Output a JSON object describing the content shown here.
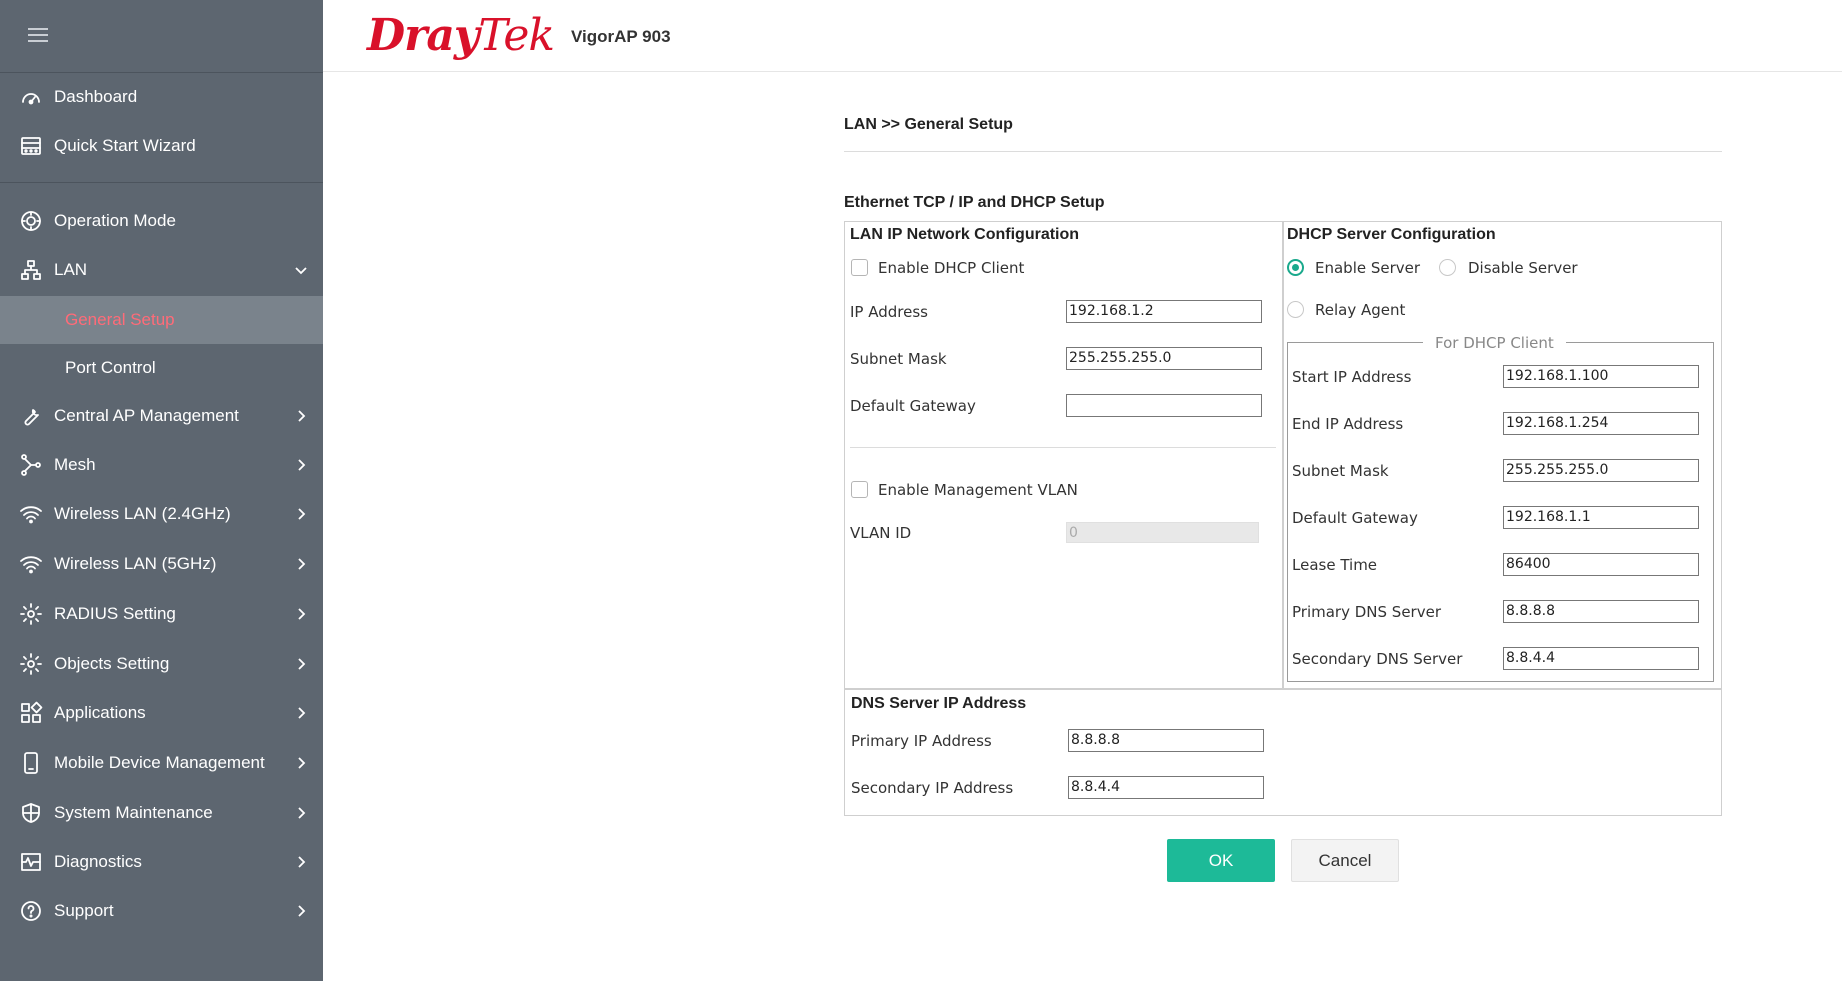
{
  "brand": {
    "logo_dray": "Dray",
    "logo_tek": "Tek",
    "model": "VigorAP 903",
    "logo_color": "#d9112a"
  },
  "sidebar": {
    "items": [
      {
        "label": "Dashboard",
        "icon": "dashboard-icon"
      },
      {
        "label": "Quick Start Wizard",
        "icon": "wizard-icon"
      },
      {
        "label": "Operation Mode",
        "icon": "operation-mode-icon"
      },
      {
        "label": "LAN",
        "icon": "lan-icon"
      },
      {
        "label": "Central AP Management",
        "icon": "wrench-icon"
      },
      {
        "label": "Mesh",
        "icon": "mesh-icon"
      },
      {
        "label": "Wireless LAN (2.4GHz)",
        "icon": "wifi-icon"
      },
      {
        "label": "Wireless LAN (5GHz)",
        "icon": "wifi-icon"
      },
      {
        "label": "RADIUS Setting",
        "icon": "gear-icon"
      },
      {
        "label": "Objects Setting",
        "icon": "gear-icon"
      },
      {
        "label": "Applications",
        "icon": "apps-icon"
      },
      {
        "label": "Mobile Device Management",
        "icon": "mobile-icon"
      },
      {
        "label": "System Maintenance",
        "icon": "globe-icon"
      },
      {
        "label": "Diagnostics",
        "icon": "diagnostics-icon"
      },
      {
        "label": "Support",
        "icon": "help-icon"
      }
    ],
    "lan_sub": [
      {
        "label": "General Setup",
        "active": true
      },
      {
        "label": "Port Control",
        "active": false
      }
    ],
    "active_color": "#ff6b78"
  },
  "page": {
    "breadcrumb": "LAN >> General Setup",
    "section_title": "Ethernet TCP / IP and DHCP Setup"
  },
  "lan_ip": {
    "title": "LAN IP Network Configuration",
    "enable_dhcp_client": "Enable DHCP Client",
    "ip_address_label": "IP Address",
    "ip_address": "192.168.1.2",
    "subnet_mask_label": "Subnet Mask",
    "subnet_mask": "255.255.255.0",
    "default_gateway_label": "Default Gateway",
    "default_gateway": "",
    "enable_mgmt_vlan": "Enable Management VLAN",
    "vlan_id_label": "VLAN ID",
    "vlan_id": "0"
  },
  "dhcp": {
    "title": "DHCP Server Configuration",
    "enable_server": "Enable Server",
    "disable_server": "Disable Server",
    "relay_agent": "Relay Agent",
    "legend": "For DHCP Client",
    "start_ip_label": "Start IP Address",
    "start_ip": "192.168.1.100",
    "end_ip_label": "End IP Address",
    "end_ip": "192.168.1.254",
    "subnet_mask_label": "Subnet Mask",
    "subnet_mask": "255.255.255.0",
    "default_gateway_label": "Default Gateway",
    "default_gateway": "192.168.1.1",
    "lease_time_label": "Lease Time",
    "lease_time": "86400",
    "primary_dns_label": "Primary DNS Server",
    "primary_dns": "8.8.8.8",
    "secondary_dns_label": "Secondary DNS Server",
    "secondary_dns": "8.8.4.4",
    "accent_color": "#1aa98c"
  },
  "dns": {
    "title": "DNS Server IP Address",
    "primary_label": "Primary IP Address",
    "primary": "8.8.8.8",
    "secondary_label": "Secondary IP Address",
    "secondary": "8.8.4.4"
  },
  "buttons": {
    "ok": "OK",
    "cancel": "Cancel",
    "ok_color": "#1dba98"
  }
}
